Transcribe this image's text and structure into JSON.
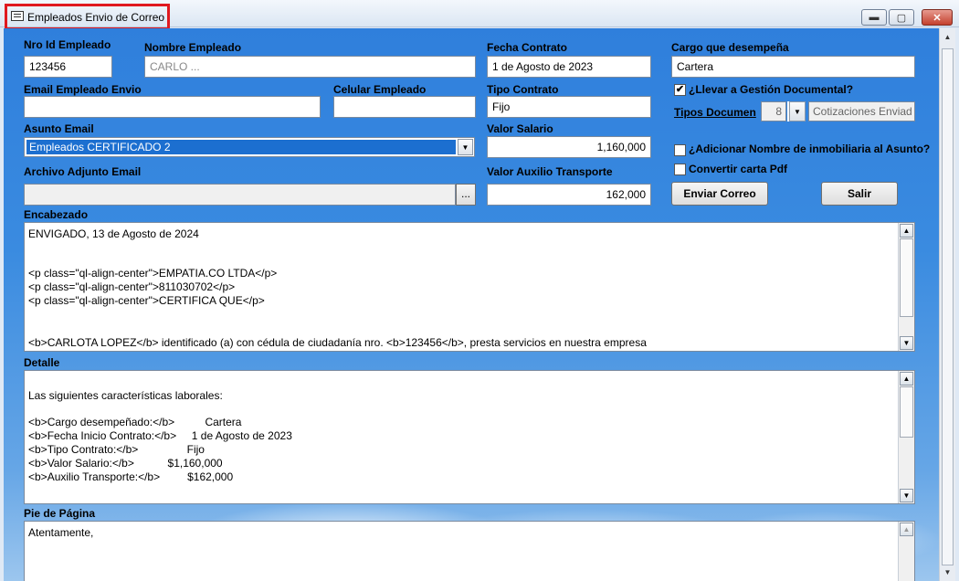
{
  "window": {
    "title": "Empleados Envio de Correo",
    "minimize": "▬",
    "maximize": "▢",
    "close": "✕"
  },
  "labels": {
    "nro_id": "Nro Id Empleado",
    "nombre": "Nombre Empleado",
    "fecha_contrato": "Fecha Contrato",
    "cargo": "Cargo que desempeña",
    "email": "Email Empleado Envio",
    "celular": "Celular Empleado",
    "tipo_contrato": "Tipo Contrato",
    "asunto": "Asunto Email",
    "valor_salario": "Valor Salario",
    "archivo": "Archivo Adjunto Email",
    "valor_auxilio": "Valor Auxilio Transporte",
    "encabezado": "Encabezado",
    "detalle": "Detalle",
    "pie": "Pie de Página"
  },
  "fields": {
    "nro_id": "123456",
    "nombre": "CARLO ...",
    "fecha_contrato": "1 de Agosto de 2023",
    "cargo": "Cartera",
    "email": "",
    "celular": "",
    "tipo_contrato": "Fijo",
    "asunto": "Empleados CERTIFICADO 2",
    "valor_salario": "1,160,000",
    "archivo": "",
    "valor_auxilio": "162,000",
    "tipos_doc_num": "8",
    "tipos_doc_name": "Cotizaciones Enviad"
  },
  "options": {
    "llevar_gestion": {
      "label": "¿Llevar a Gestión Documental?",
      "checked": true
    },
    "tipos_documen": "Tipos Documen",
    "adicionar_nombre": {
      "label": "¿Adicionar Nombre de inmobiliaria al Asunto?",
      "checked": false
    },
    "convertir_pdf": {
      "label": "Convertir carta Pdf",
      "checked": false
    }
  },
  "buttons": {
    "enviar": "Enviar Correo",
    "salir": "Salir",
    "browse": "..."
  },
  "encabezado_lines": [
    "ENVIGADO, 13 de Agosto de 2024",
    "",
    "",
    "<p class=\"ql-align-center\">EMPATIA.CO LTDA</p>",
    "<p class=\"ql-align-center\">811030702</p>",
    "<p class=\"ql-align-center\">CERTIFICA QUE</p>",
    "",
    "",
    "<b>CARLOTA LOPEZ</b> identificado (a) con cédula de ciudadanía nro. <b>123456</b>, presta servicios en nuestra empresa"
  ],
  "detalle_lines": [
    "",
    "Las siguientes características laborales:",
    "",
    "<b>Cargo desempeñado:</b>          Cartera",
    "<b>Fecha Inicio Contrato:</b>     1 de Agosto de 2023",
    "<b>Tipo Contrato:</b>                Fijo",
    "<b>Valor Salario:</b>           $1,160,000",
    "<b>Auxilio Transporte:</b>         $162,000"
  ],
  "pie_lines": [
    "Atentamente,"
  ]
}
